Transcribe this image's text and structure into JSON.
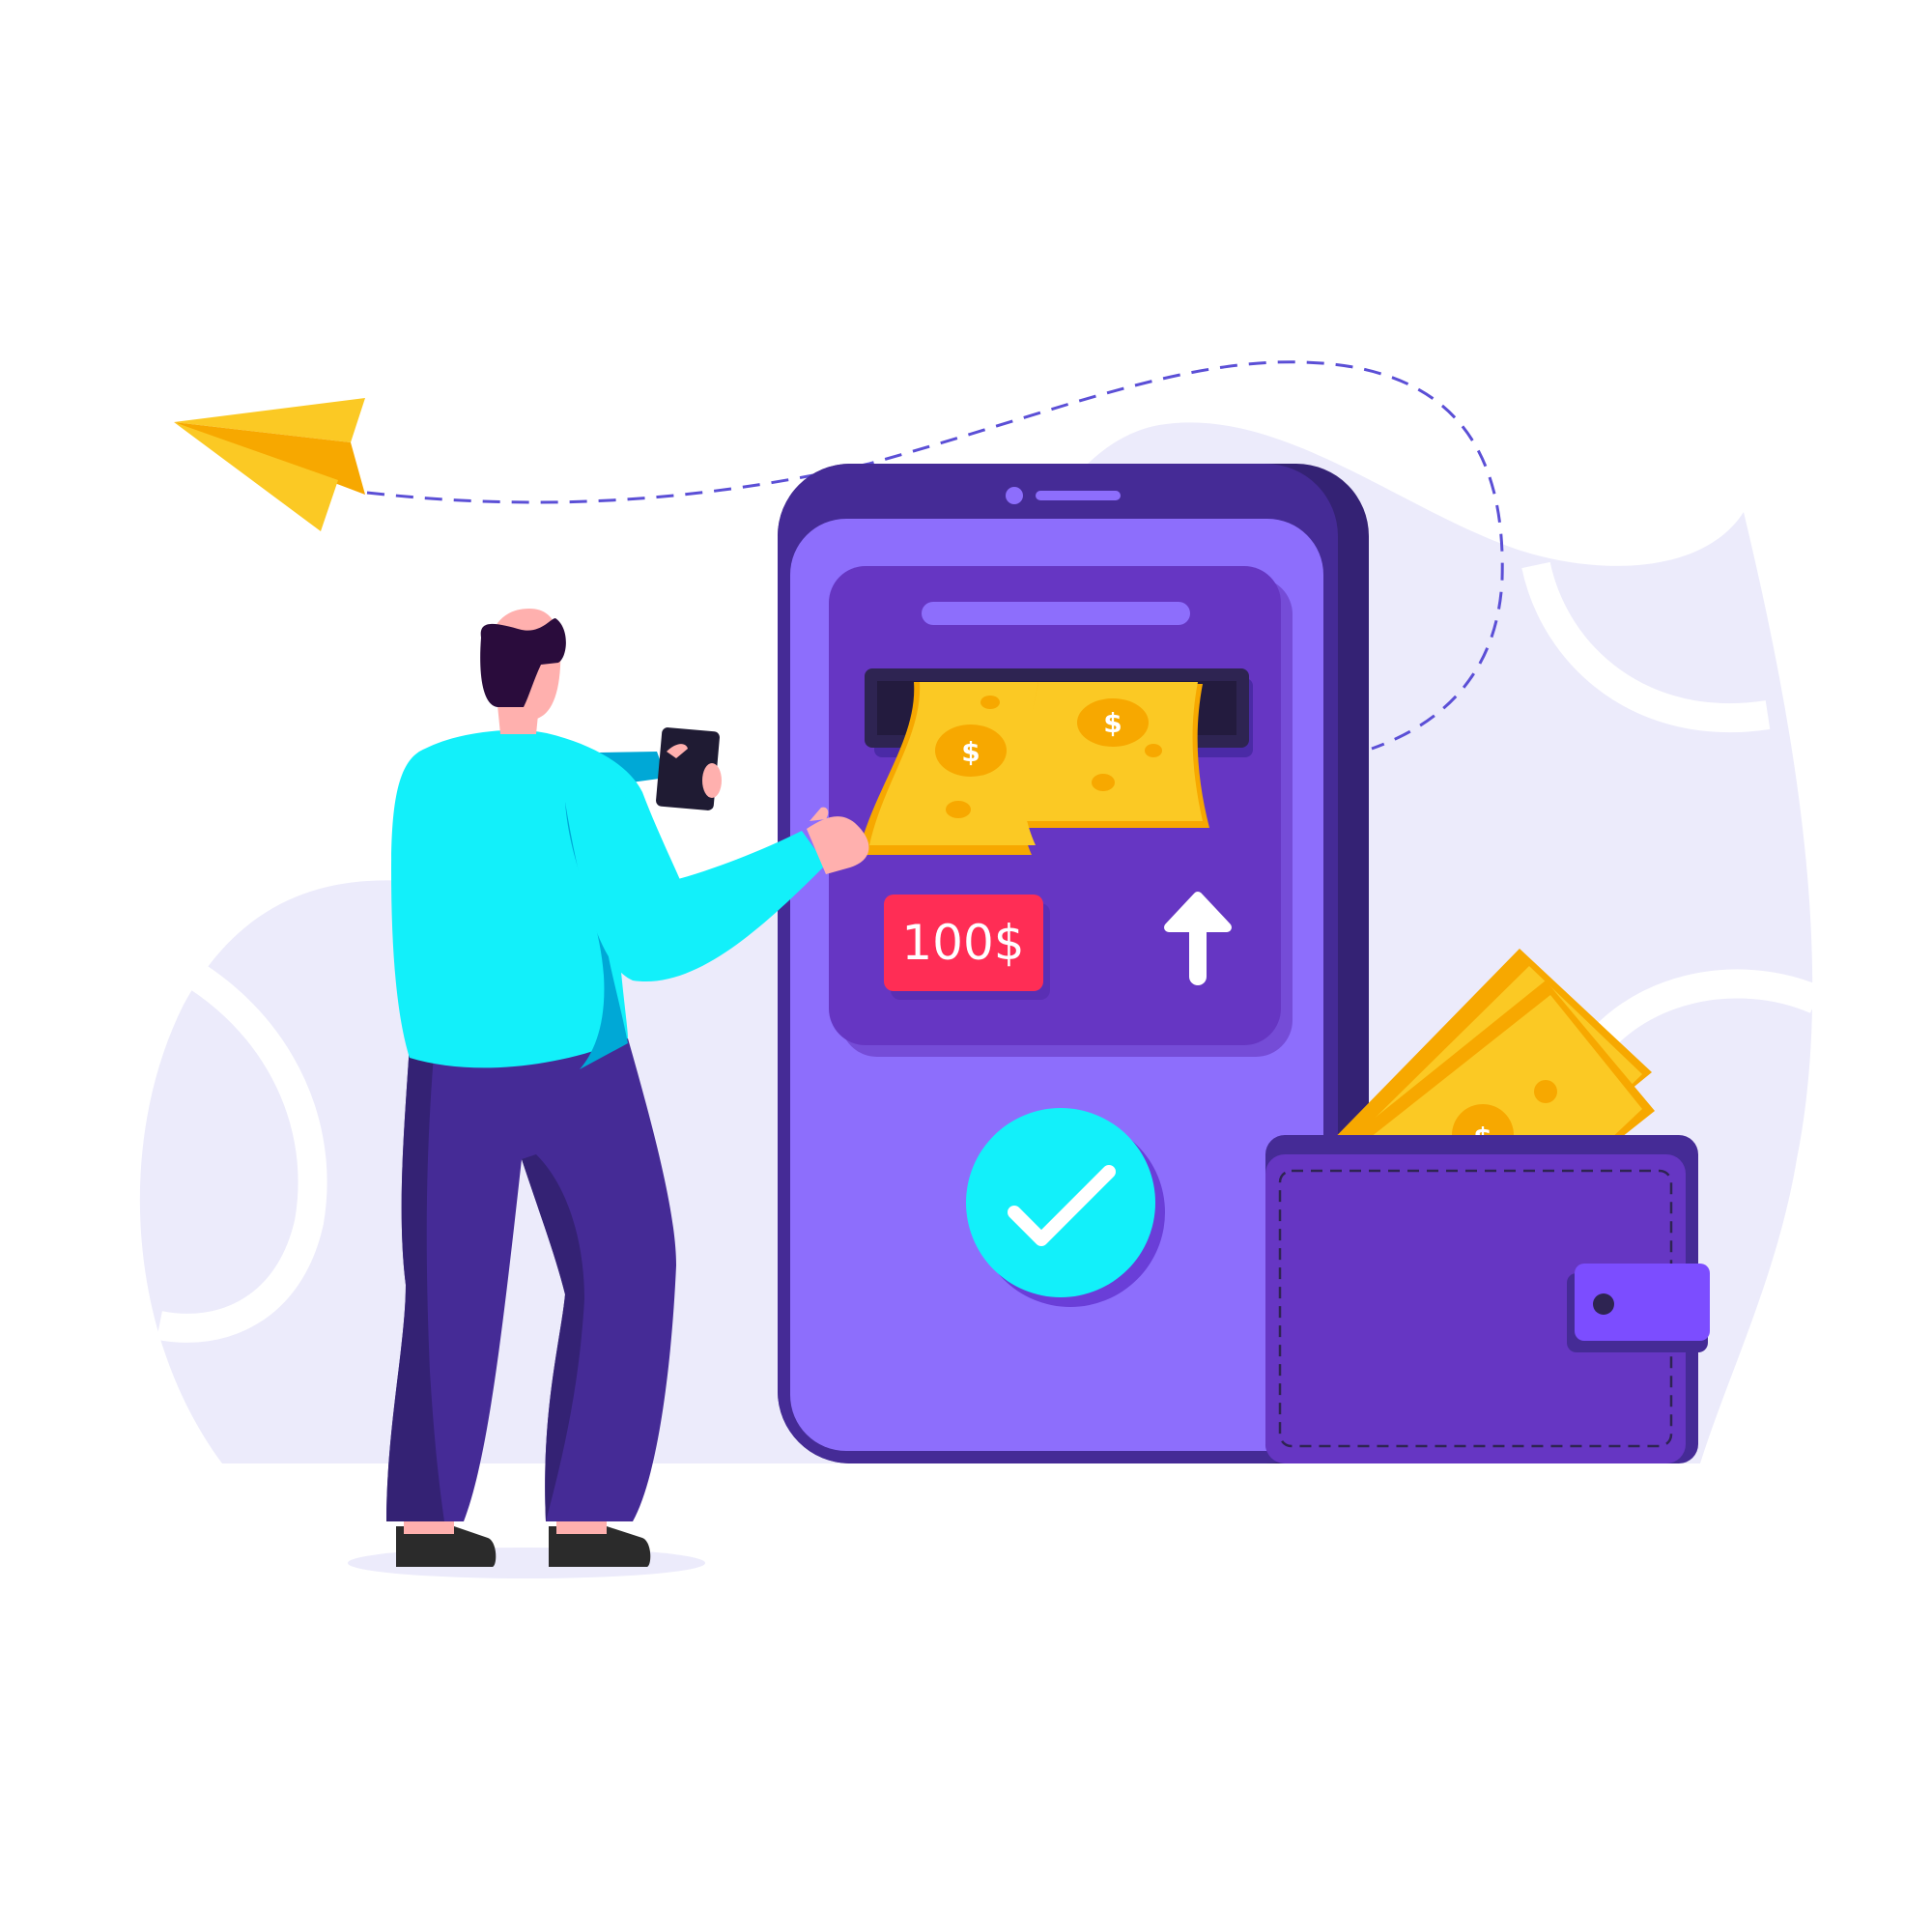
{
  "transfer": {
    "amount_label": "100$"
  },
  "icons": {
    "paper_plane": "paper-plane-icon",
    "confirm": "checkmark-icon",
    "upload": "arrow-up-icon",
    "currency": "dollar-sign-icon"
  },
  "colors": {
    "phone_frame": "#452B96",
    "phone_screen": "#8D6EFC",
    "panel": "#6636C3",
    "amount_badge": "#FF2D55",
    "check_circle": "#12F0FA",
    "cash": "#FBC924",
    "cash_dark": "#F7A800",
    "wallet": "#6636C3",
    "wallet_clasp": "#7C4DFF",
    "shirt": "#12F0FA",
    "pants": "#452B96",
    "background_blob": "#ECEBFB",
    "path_dashes": "#5B4FD6"
  }
}
